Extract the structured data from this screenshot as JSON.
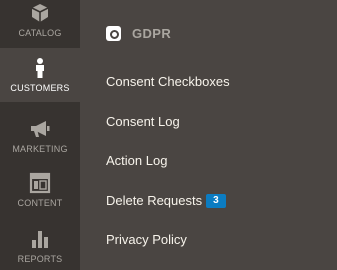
{
  "sidebar": {
    "items": [
      {
        "label": "CATALOG",
        "icon": "catalog-icon"
      },
      {
        "label": "CUSTOMERS",
        "icon": "customers-icon",
        "active": true
      },
      {
        "label": "MARKETING",
        "icon": "marketing-icon"
      },
      {
        "label": "CONTENT",
        "icon": "content-icon"
      },
      {
        "label": "REPORTS",
        "icon": "reports-icon"
      }
    ]
  },
  "panel": {
    "title": "GDPR",
    "logo": "brand-logo-icon",
    "links": [
      {
        "label": "Consent Checkboxes"
      },
      {
        "label": "Consent Log"
      },
      {
        "label": "Action Log"
      },
      {
        "label": "Delete Requests",
        "badge": "3"
      },
      {
        "label": "Privacy Policy"
      }
    ]
  },
  "colors": {
    "sidebar_bg": "#373330",
    "panel_bg": "#4a4542",
    "link_text": "#f7f3eb",
    "muted_text": "#aaa6a0",
    "badge_bg": "#0b7cc2"
  }
}
